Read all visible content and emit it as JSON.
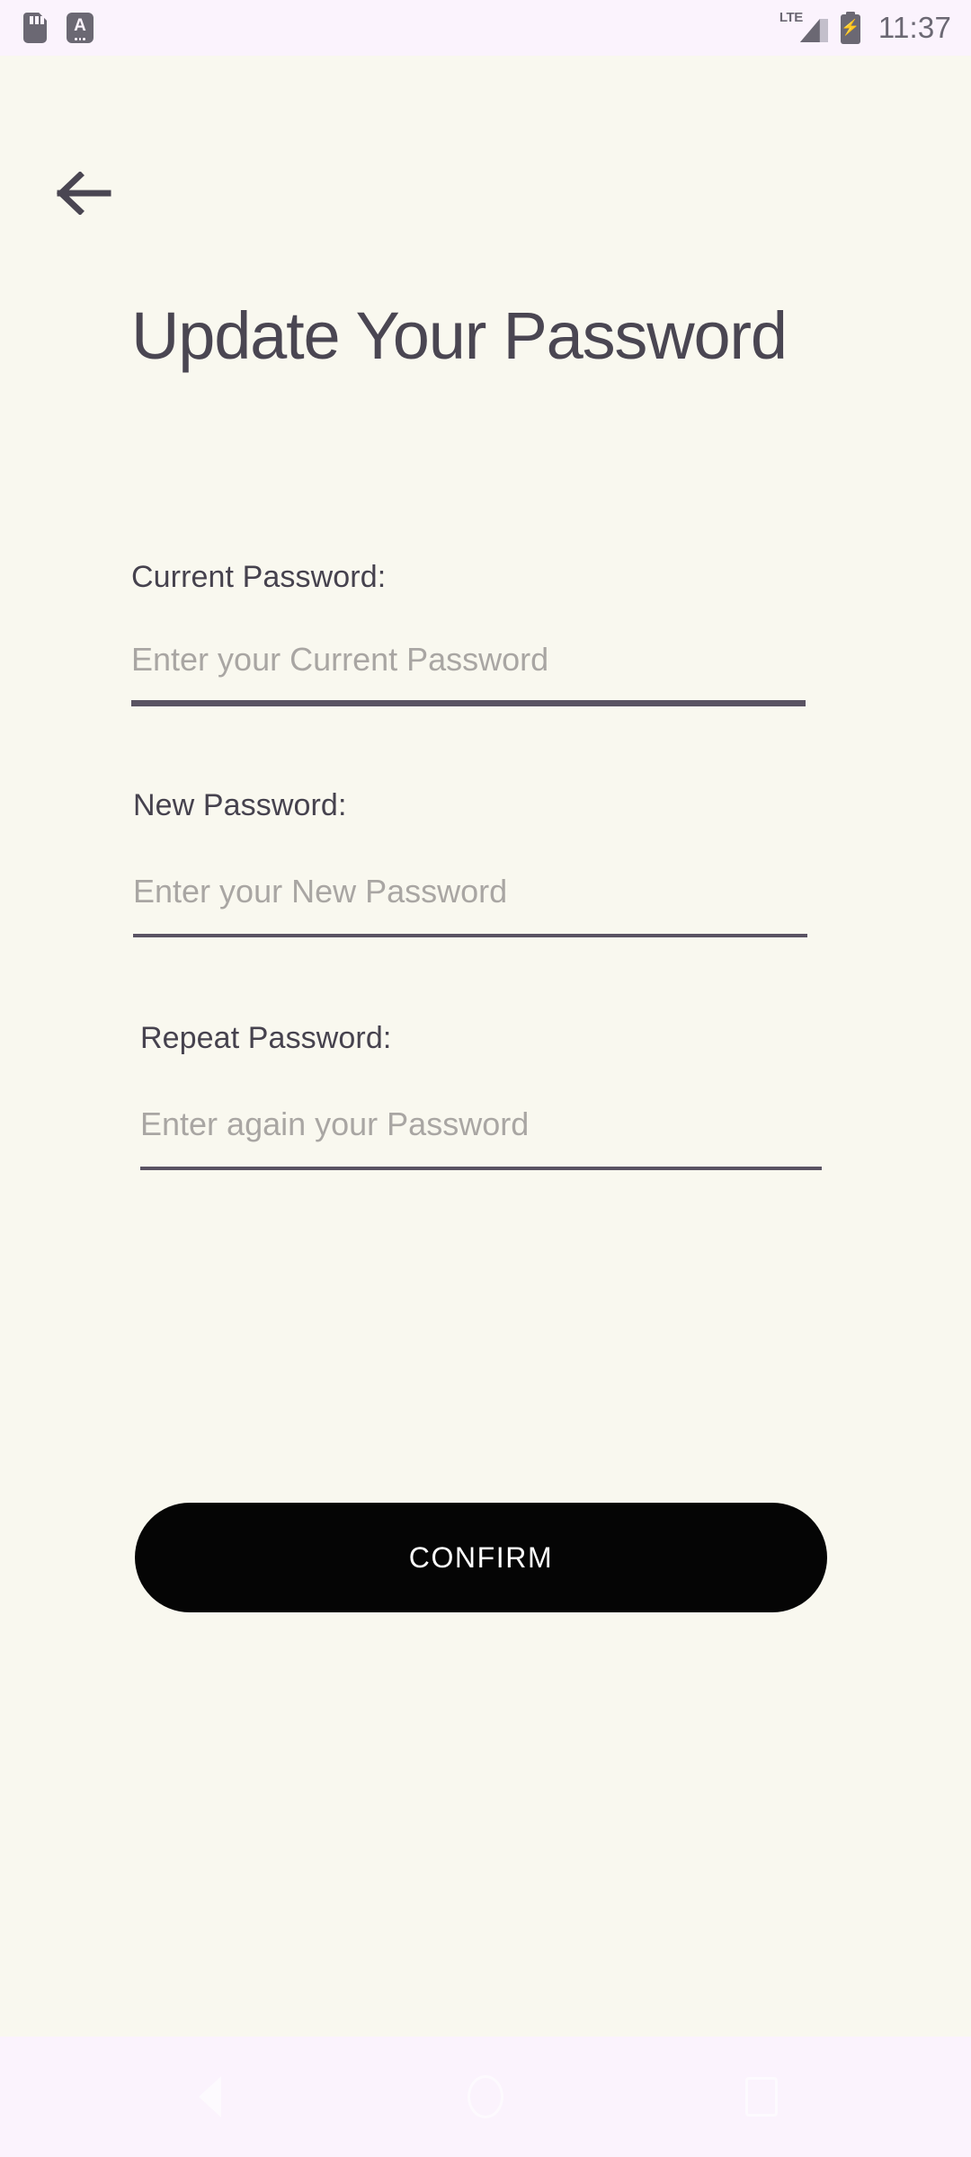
{
  "status_bar": {
    "icons": [
      {
        "name": "sd-card-icon",
        "glyph": "sd-card"
      },
      {
        "name": "font-size-a-icon",
        "glyph": "A"
      }
    ],
    "network_label": "LTE",
    "signal_icon": "signal-bars-icon",
    "battery_icon": "battery-charging-icon",
    "battery_glyph": "⚡",
    "time": "11:37",
    "background_color": "#FBF3FD",
    "icon_color": "#6B6873"
  },
  "header": {
    "back_icon": "arrow-left-icon",
    "title": "Update Your Password"
  },
  "form": {
    "fields": [
      {
        "label": "Current Password:",
        "placeholder": "Enter your Current Password",
        "value": "",
        "focused": true
      },
      {
        "label": "New Password:",
        "placeholder": "Enter your New Password",
        "value": "",
        "focused": false
      },
      {
        "label": "Repeat Password:",
        "placeholder": "Enter again your Password",
        "value": "",
        "focused": false
      }
    ],
    "confirm_label": "CONFIRM"
  },
  "theme": {
    "page_background": "#F9F8EF",
    "text_color": "#46424E",
    "title_color": "#4A4652",
    "placeholder_color": "#A9A6A3",
    "underline_color": "#5A5363",
    "button_background": "#050505",
    "button_text_color": "#FFFFFF",
    "system_bar_color": "#FBF3FD"
  },
  "nav_bar": {
    "buttons": [
      {
        "name": "nav-back-button",
        "icon": "triangle-back-icon"
      },
      {
        "name": "nav-home-button",
        "icon": "circle-home-icon"
      },
      {
        "name": "nav-recents-button",
        "icon": "square-recents-icon"
      }
    ]
  }
}
